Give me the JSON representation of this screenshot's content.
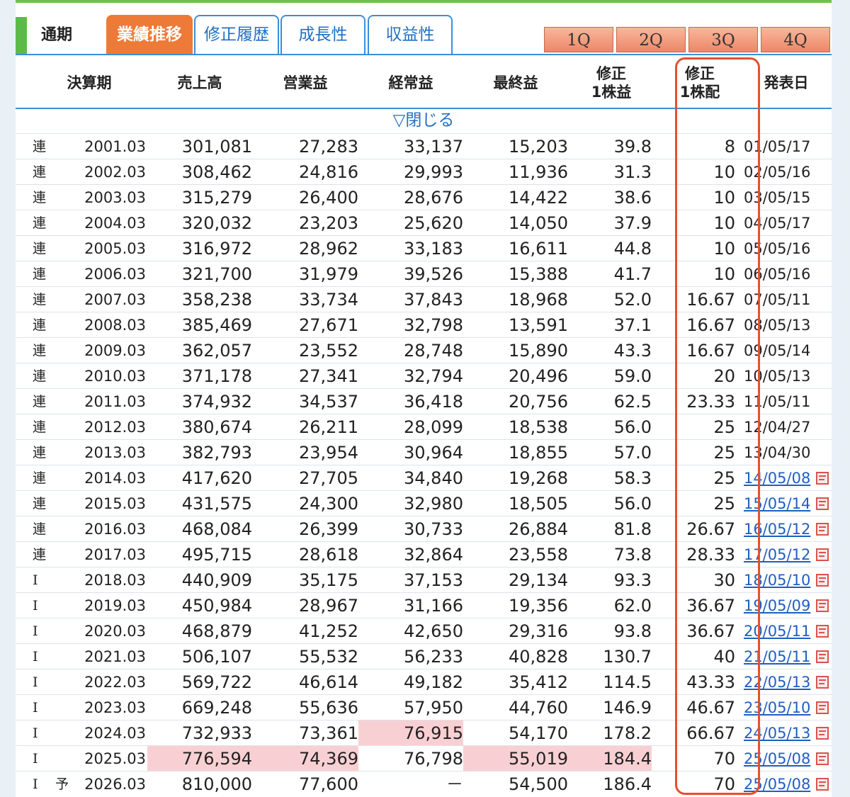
{
  "header": {
    "period_label": "通期",
    "tabs": [
      {
        "label": "業績推移",
        "active": true
      },
      {
        "label": "修正履歴",
        "active": false
      },
      {
        "label": "成長性",
        "active": false
      },
      {
        "label": "収益性",
        "active": false
      }
    ],
    "quarter_buttons": [
      "1Q",
      "2Q",
      "3Q",
      "4Q"
    ]
  },
  "table": {
    "columns": {
      "period": "決算期",
      "revenue": "売上高",
      "operating": "営業益",
      "ordinary": "経常益",
      "net": "最終益",
      "eps_line1": "修正",
      "eps_line2": "1株益",
      "dps_line1": "修正",
      "dps_line2": "1株配",
      "announce": "発表日"
    },
    "close_label": "▽閉じる",
    "rows": [
      {
        "type": "連",
        "fc": "",
        "period": "2001.03",
        "revenue": "301,081",
        "operating": "27,283",
        "ordinary": "33,137",
        "net": "15,203",
        "eps": "39.8",
        "dps": "8",
        "date": "01/05/17",
        "link": false
      },
      {
        "type": "連",
        "fc": "",
        "period": "2002.03",
        "revenue": "308,462",
        "operating": "24,816",
        "ordinary": "29,993",
        "net": "11,936",
        "eps": "31.3",
        "dps": "10",
        "date": "02/05/16",
        "link": false
      },
      {
        "type": "連",
        "fc": "",
        "period": "2003.03",
        "revenue": "315,279",
        "operating": "26,400",
        "ordinary": "28,676",
        "net": "14,422",
        "eps": "38.6",
        "dps": "10",
        "date": "03/05/15",
        "link": false
      },
      {
        "type": "連",
        "fc": "",
        "period": "2004.03",
        "revenue": "320,032",
        "operating": "23,203",
        "ordinary": "25,620",
        "net": "14,050",
        "eps": "37.9",
        "dps": "10",
        "date": "04/05/17",
        "link": false
      },
      {
        "type": "連",
        "fc": "",
        "period": "2005.03",
        "revenue": "316,972",
        "operating": "28,962",
        "ordinary": "33,183",
        "net": "16,611",
        "eps": "44.8",
        "dps": "10",
        "date": "05/05/16",
        "link": false
      },
      {
        "type": "連",
        "fc": "",
        "period": "2006.03",
        "revenue": "321,700",
        "operating": "31,979",
        "ordinary": "39,526",
        "net": "15,388",
        "eps": "41.7",
        "dps": "10",
        "date": "06/05/16",
        "link": false
      },
      {
        "type": "連",
        "fc": "",
        "period": "2007.03",
        "revenue": "358,238",
        "operating": "33,734",
        "ordinary": "37,843",
        "net": "18,968",
        "eps": "52.0",
        "dps": "16.67",
        "date": "07/05/11",
        "link": false
      },
      {
        "type": "連",
        "fc": "",
        "period": "2008.03",
        "revenue": "385,469",
        "operating": "27,671",
        "ordinary": "32,798",
        "net": "13,591",
        "eps": "37.1",
        "dps": "16.67",
        "date": "08/05/13",
        "link": false
      },
      {
        "type": "連",
        "fc": "",
        "period": "2009.03",
        "revenue": "362,057",
        "operating": "23,552",
        "ordinary": "28,748",
        "net": "15,890",
        "eps": "43.3",
        "dps": "16.67",
        "date": "09/05/14",
        "link": false
      },
      {
        "type": "連",
        "fc": "",
        "period": "2010.03",
        "revenue": "371,178",
        "operating": "27,341",
        "ordinary": "32,794",
        "net": "20,496",
        "eps": "59.0",
        "dps": "20",
        "date": "10/05/13",
        "link": false
      },
      {
        "type": "連",
        "fc": "",
        "period": "2011.03",
        "revenue": "374,932",
        "operating": "34,537",
        "ordinary": "36,418",
        "net": "20,756",
        "eps": "62.5",
        "dps": "23.33",
        "date": "11/05/11",
        "link": false
      },
      {
        "type": "連",
        "fc": "",
        "period": "2012.03",
        "revenue": "380,674",
        "operating": "26,211",
        "ordinary": "28,099",
        "net": "18,538",
        "eps": "56.0",
        "dps": "25",
        "date": "12/04/27",
        "link": false
      },
      {
        "type": "連",
        "fc": "",
        "period": "2013.03",
        "revenue": "382,793",
        "operating": "23,954",
        "ordinary": "30,964",
        "net": "18,855",
        "eps": "57.0",
        "dps": "25",
        "date": "13/04/30",
        "link": false
      },
      {
        "type": "連",
        "fc": "",
        "period": "2014.03",
        "revenue": "417,620",
        "operating": "27,705",
        "ordinary": "34,840",
        "net": "19,268",
        "eps": "58.3",
        "dps": "25",
        "date": "14/05/08",
        "link": true
      },
      {
        "type": "連",
        "fc": "",
        "period": "2015.03",
        "revenue": "431,575",
        "operating": "24,300",
        "ordinary": "32,980",
        "net": "18,505",
        "eps": "56.0",
        "dps": "25",
        "date": "15/05/14",
        "link": true
      },
      {
        "type": "連",
        "fc": "",
        "period": "2016.03",
        "revenue": "468,084",
        "operating": "26,399",
        "ordinary": "30,733",
        "net": "26,884",
        "eps": "81.8",
        "dps": "26.67",
        "date": "16/05/12",
        "link": true
      },
      {
        "type": "連",
        "fc": "",
        "period": "2017.03",
        "revenue": "495,715",
        "operating": "28,618",
        "ordinary": "32,864",
        "net": "23,558",
        "eps": "73.8",
        "dps": "28.33",
        "date": "17/05/12",
        "link": true
      },
      {
        "type": "I",
        "fc": "",
        "period": "2018.03",
        "revenue": "440,909",
        "operating": "35,175",
        "ordinary": "37,153",
        "net": "29,134",
        "eps": "93.3",
        "dps": "30",
        "date": "18/05/10",
        "link": true
      },
      {
        "type": "I",
        "fc": "",
        "period": "2019.03",
        "revenue": "450,984",
        "operating": "28,967",
        "ordinary": "31,166",
        "net": "19,356",
        "eps": "62.0",
        "dps": "36.67",
        "date": "19/05/09",
        "link": true
      },
      {
        "type": "I",
        "fc": "",
        "period": "2020.03",
        "revenue": "468,879",
        "operating": "41,252",
        "ordinary": "42,650",
        "net": "29,316",
        "eps": "93.8",
        "dps": "36.67",
        "date": "20/05/11",
        "link": true
      },
      {
        "type": "I",
        "fc": "",
        "period": "2021.03",
        "revenue": "506,107",
        "operating": "55,532",
        "ordinary": "56,233",
        "net": "40,828",
        "eps": "130.7",
        "dps": "40",
        "date": "21/05/11",
        "link": true
      },
      {
        "type": "I",
        "fc": "",
        "period": "2022.03",
        "revenue": "569,722",
        "operating": "46,614",
        "ordinary": "49,182",
        "net": "35,412",
        "eps": "114.5",
        "dps": "43.33",
        "date": "22/05/13",
        "link": true
      },
      {
        "type": "I",
        "fc": "",
        "period": "2023.03",
        "revenue": "669,248",
        "operating": "55,636",
        "ordinary": "57,950",
        "net": "44,760",
        "eps": "146.9",
        "dps": "46.67",
        "date": "23/05/10",
        "link": true
      },
      {
        "type": "I",
        "fc": "",
        "period": "2024.03",
        "revenue": "732,933",
        "operating": "73,361",
        "ordinary": "76,915",
        "net": "54,170",
        "eps": "178.2",
        "dps": "66.67",
        "date": "24/05/13",
        "link": true,
        "highlight": [
          "ordinary"
        ]
      },
      {
        "type": "I",
        "fc": "",
        "period": "2025.03",
        "revenue": "776,594",
        "operating": "74,369",
        "ordinary": "76,798",
        "net": "55,019",
        "eps": "184.4",
        "dps": "70",
        "date": "25/05/08",
        "link": true,
        "highlight": [
          "revenue",
          "operating",
          "net",
          "eps"
        ]
      },
      {
        "type": "I",
        "fc": "予",
        "period": "2026.03",
        "revenue": "810,000",
        "operating": "77,600",
        "ordinary": "－",
        "net": "54,500",
        "eps": "186.4",
        "dps": "70",
        "date": "25/05/08",
        "link": true
      }
    ]
  },
  "colors": {
    "accent_green": "#5cbb48",
    "tab_active": "#ee7a37",
    "tab_border": "#3b8fd9",
    "highlight_cell": "#f8d0d3",
    "annotation_red": "#e5502e"
  }
}
